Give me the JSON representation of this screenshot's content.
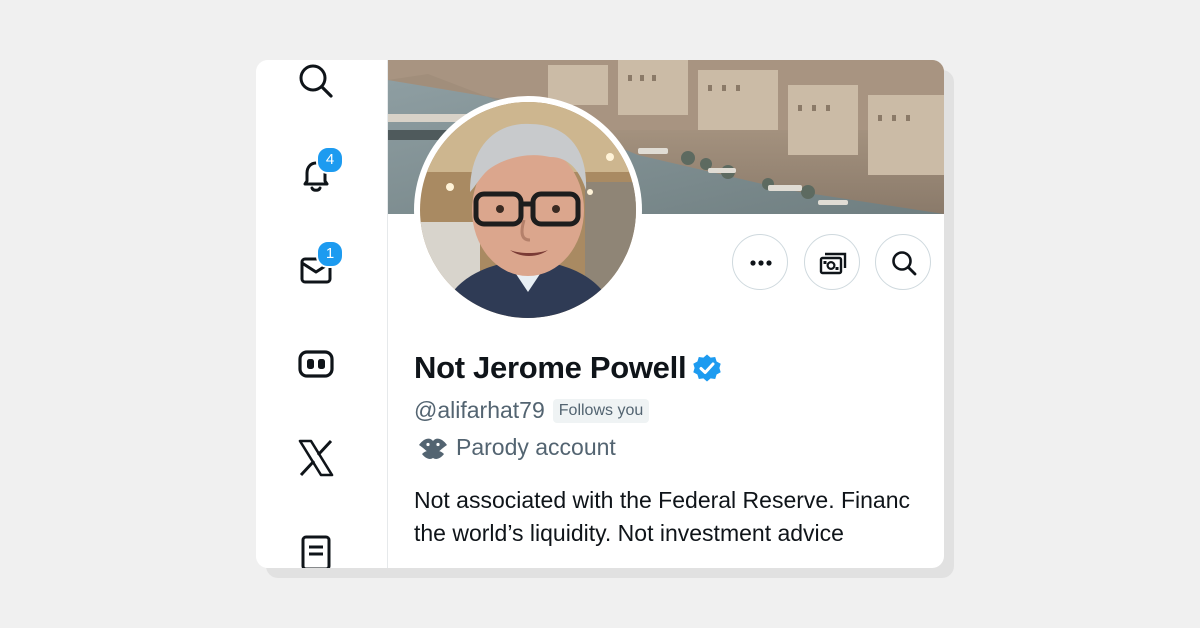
{
  "sidebar": {
    "items": [
      {
        "icon": "search-icon"
      },
      {
        "icon": "bell-icon",
        "badge": "4"
      },
      {
        "icon": "mail-icon",
        "badge": "1"
      },
      {
        "icon": "grok-icon"
      },
      {
        "icon": "x-logo-icon"
      },
      {
        "icon": "lists-icon"
      }
    ]
  },
  "profile": {
    "name": "Not Jerome Powell",
    "handle": "@alifarhat79",
    "follows_you": "Follows you",
    "parody_label": "Parody account",
    "bio_line1": "Not associated with the Federal Reserve. Financ",
    "bio_line2": "the world’s liquidity. Not investment advice"
  },
  "actions": [
    {
      "icon": "more-icon"
    },
    {
      "icon": "money-icon"
    },
    {
      "icon": "search-icon"
    }
  ],
  "colors": {
    "accent": "#1d9bf0",
    "text_primary": "#0f1419",
    "text_secondary": "#536471"
  }
}
